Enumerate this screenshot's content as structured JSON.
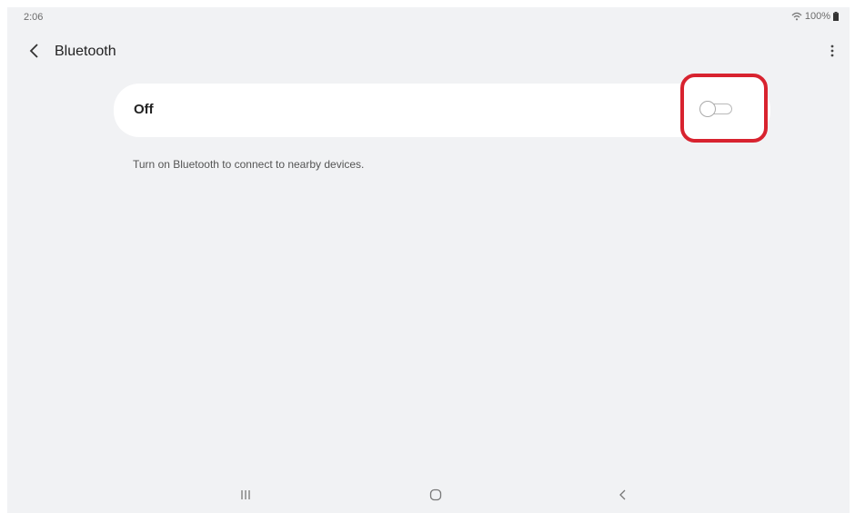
{
  "status_bar": {
    "time": "2:06",
    "battery": "100%",
    "icons": [
      "wifi-icon",
      "battery-icon"
    ]
  },
  "app_bar": {
    "title": "Bluetooth",
    "back_icon": "chevron-left-icon",
    "more_icon": "more-vert-icon"
  },
  "bluetooth": {
    "state_label": "Off",
    "enabled": false,
    "description": "Turn on Bluetooth to connect to nearby devices."
  },
  "nav_bar": {
    "buttons": [
      "recents-icon",
      "home-icon",
      "back-icon"
    ]
  },
  "colors": {
    "background": "#f1f2f4",
    "card": "#ffffff",
    "highlight": "#d8232f",
    "text": "#222222"
  }
}
